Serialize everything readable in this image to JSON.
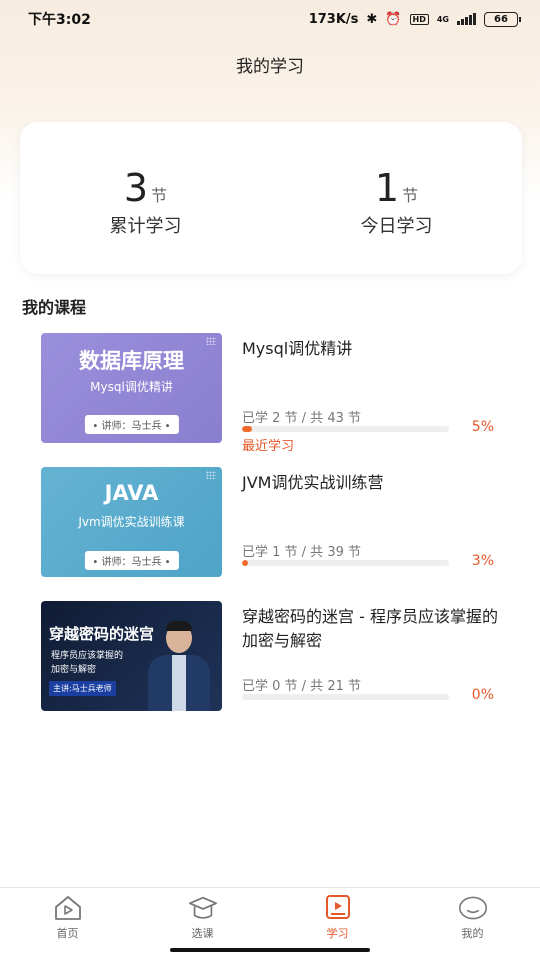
{
  "status_bar": {
    "time": "下午3:02",
    "network_speed": "173K/s",
    "battery": "66",
    "hd": "HD",
    "net_type": "4G"
  },
  "page": {
    "title": "我的学习"
  },
  "stats": [
    {
      "value": "3",
      "unit": "节",
      "label": "累计学习"
    },
    {
      "value": "1",
      "unit": "节",
      "label": "今日学习"
    }
  ],
  "section": {
    "title": "我的课程"
  },
  "courses": [
    {
      "title": "Mysql调优精讲",
      "progress_text": "已学 2 节 / 共 43 节",
      "percent_label": "5%",
      "progress": 0.05,
      "recent": "最近学习",
      "thumb": {
        "title": "数据库原理",
        "subtitle": "Mysql调优精讲",
        "tag": "• 讲师：马士兵 •"
      }
    },
    {
      "title": "JVM调优实战训练营",
      "progress_text": "已学 1 节 / 共 39 节",
      "percent_label": "3%",
      "progress": 0.03,
      "thumb": {
        "title": "JAVA",
        "subtitle": "Jvm调优实战训练课",
        "tag": "• 讲师：马士兵 •"
      }
    },
    {
      "title": "穿越密码的迷宫 - 程序员应该掌握的加密与解密",
      "progress_text": "已学 0 节 / 共 21 节",
      "percent_label": "0%",
      "progress": 0,
      "thumb": {
        "title": "穿越密码的迷宫",
        "line1": "程序员应该掌握的",
        "line2": "加密与解密",
        "tag": "主讲:马士兵老师"
      }
    }
  ],
  "tabs": [
    {
      "label": "首页",
      "icon": "home-play-icon"
    },
    {
      "label": "选课",
      "icon": "graduation-cap-icon"
    },
    {
      "label": "学习",
      "icon": "study-book-icon",
      "active": true
    },
    {
      "label": "我的",
      "icon": "profile-face-icon"
    }
  ],
  "colors": {
    "accent": "#e5582a",
    "progress_fill": "#ef6a2d"
  }
}
